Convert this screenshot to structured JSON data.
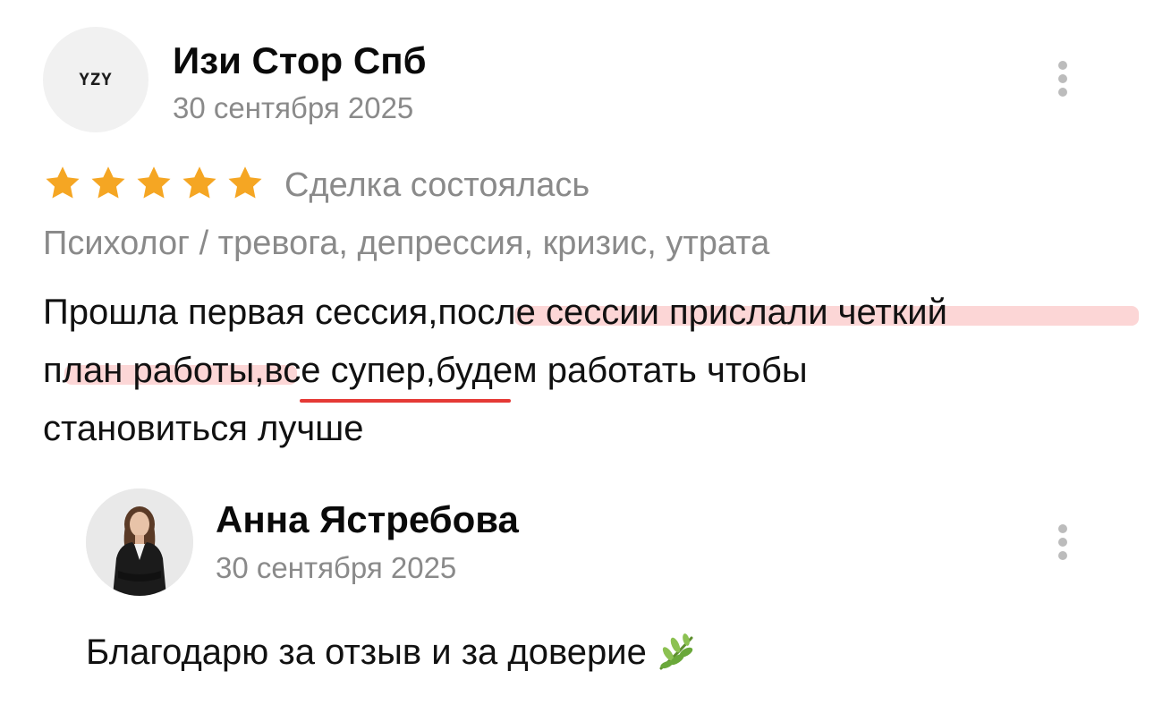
{
  "review": {
    "author": {
      "avatar_text": "YZY",
      "name": "Изи Стор Спб",
      "date": "30 сентября 2025"
    },
    "rating": {
      "stars": 5,
      "max": 5,
      "color": "#f5a623"
    },
    "deal_status": "Сделка состоялась",
    "category": "Психолог / тревога, депрессия, кризис, утрата",
    "text_lines": [
      "Прошла первая сессия,после сессии прислали четкий",
      "план работы,все супер,будем работать чтобы",
      "становиться лучше"
    ],
    "menu_icon": "more-vertical-icon"
  },
  "reply": {
    "author": {
      "name": "Анна Ястребова",
      "date": "30 сентября 2025"
    },
    "text": "Благодарю за отзыв и за доверие",
    "emoji_icon": "herb-leaf-icon",
    "menu_icon": "more-vertical-icon"
  },
  "colors": {
    "highlight": "#f47878",
    "underline": "#e53935",
    "muted_text": "#8a8a8a"
  }
}
